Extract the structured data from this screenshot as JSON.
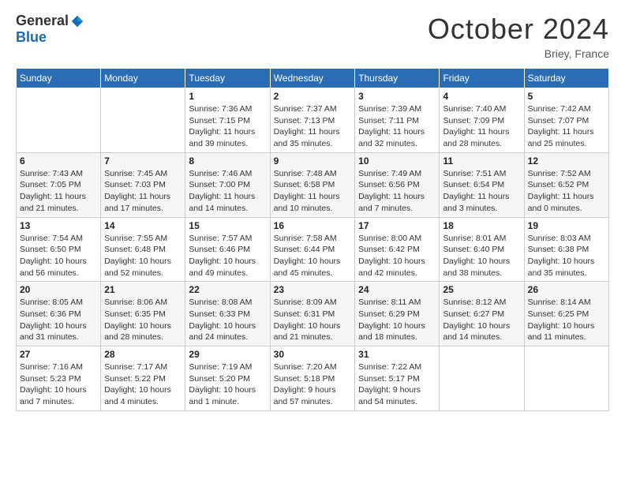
{
  "header": {
    "logo_general": "General",
    "logo_blue": "Blue",
    "month_title": "October 2024",
    "location": "Briey, France"
  },
  "days_of_week": [
    "Sunday",
    "Monday",
    "Tuesday",
    "Wednesday",
    "Thursday",
    "Friday",
    "Saturday"
  ],
  "weeks": [
    [
      {
        "num": "",
        "sunrise": "",
        "sunset": "",
        "daylight": ""
      },
      {
        "num": "",
        "sunrise": "",
        "sunset": "",
        "daylight": ""
      },
      {
        "num": "1",
        "sunrise": "Sunrise: 7:36 AM",
        "sunset": "Sunset: 7:15 PM",
        "daylight": "Daylight: 11 hours and 39 minutes."
      },
      {
        "num": "2",
        "sunrise": "Sunrise: 7:37 AM",
        "sunset": "Sunset: 7:13 PM",
        "daylight": "Daylight: 11 hours and 35 minutes."
      },
      {
        "num": "3",
        "sunrise": "Sunrise: 7:39 AM",
        "sunset": "Sunset: 7:11 PM",
        "daylight": "Daylight: 11 hours and 32 minutes."
      },
      {
        "num": "4",
        "sunrise": "Sunrise: 7:40 AM",
        "sunset": "Sunset: 7:09 PM",
        "daylight": "Daylight: 11 hours and 28 minutes."
      },
      {
        "num": "5",
        "sunrise": "Sunrise: 7:42 AM",
        "sunset": "Sunset: 7:07 PM",
        "daylight": "Daylight: 11 hours and 25 minutes."
      }
    ],
    [
      {
        "num": "6",
        "sunrise": "Sunrise: 7:43 AM",
        "sunset": "Sunset: 7:05 PM",
        "daylight": "Daylight: 11 hours and 21 minutes."
      },
      {
        "num": "7",
        "sunrise": "Sunrise: 7:45 AM",
        "sunset": "Sunset: 7:03 PM",
        "daylight": "Daylight: 11 hours and 17 minutes."
      },
      {
        "num": "8",
        "sunrise": "Sunrise: 7:46 AM",
        "sunset": "Sunset: 7:00 PM",
        "daylight": "Daylight: 11 hours and 14 minutes."
      },
      {
        "num": "9",
        "sunrise": "Sunrise: 7:48 AM",
        "sunset": "Sunset: 6:58 PM",
        "daylight": "Daylight: 11 hours and 10 minutes."
      },
      {
        "num": "10",
        "sunrise": "Sunrise: 7:49 AM",
        "sunset": "Sunset: 6:56 PM",
        "daylight": "Daylight: 11 hours and 7 minutes."
      },
      {
        "num": "11",
        "sunrise": "Sunrise: 7:51 AM",
        "sunset": "Sunset: 6:54 PM",
        "daylight": "Daylight: 11 hours and 3 minutes."
      },
      {
        "num": "12",
        "sunrise": "Sunrise: 7:52 AM",
        "sunset": "Sunset: 6:52 PM",
        "daylight": "Daylight: 11 hours and 0 minutes."
      }
    ],
    [
      {
        "num": "13",
        "sunrise": "Sunrise: 7:54 AM",
        "sunset": "Sunset: 6:50 PM",
        "daylight": "Daylight: 10 hours and 56 minutes."
      },
      {
        "num": "14",
        "sunrise": "Sunrise: 7:55 AM",
        "sunset": "Sunset: 6:48 PM",
        "daylight": "Daylight: 10 hours and 52 minutes."
      },
      {
        "num": "15",
        "sunrise": "Sunrise: 7:57 AM",
        "sunset": "Sunset: 6:46 PM",
        "daylight": "Daylight: 10 hours and 49 minutes."
      },
      {
        "num": "16",
        "sunrise": "Sunrise: 7:58 AM",
        "sunset": "Sunset: 6:44 PM",
        "daylight": "Daylight: 10 hours and 45 minutes."
      },
      {
        "num": "17",
        "sunrise": "Sunrise: 8:00 AM",
        "sunset": "Sunset: 6:42 PM",
        "daylight": "Daylight: 10 hours and 42 minutes."
      },
      {
        "num": "18",
        "sunrise": "Sunrise: 8:01 AM",
        "sunset": "Sunset: 6:40 PM",
        "daylight": "Daylight: 10 hours and 38 minutes."
      },
      {
        "num": "19",
        "sunrise": "Sunrise: 8:03 AM",
        "sunset": "Sunset: 6:38 PM",
        "daylight": "Daylight: 10 hours and 35 minutes."
      }
    ],
    [
      {
        "num": "20",
        "sunrise": "Sunrise: 8:05 AM",
        "sunset": "Sunset: 6:36 PM",
        "daylight": "Daylight: 10 hours and 31 minutes."
      },
      {
        "num": "21",
        "sunrise": "Sunrise: 8:06 AM",
        "sunset": "Sunset: 6:35 PM",
        "daylight": "Daylight: 10 hours and 28 minutes."
      },
      {
        "num": "22",
        "sunrise": "Sunrise: 8:08 AM",
        "sunset": "Sunset: 6:33 PM",
        "daylight": "Daylight: 10 hours and 24 minutes."
      },
      {
        "num": "23",
        "sunrise": "Sunrise: 8:09 AM",
        "sunset": "Sunset: 6:31 PM",
        "daylight": "Daylight: 10 hours and 21 minutes."
      },
      {
        "num": "24",
        "sunrise": "Sunrise: 8:11 AM",
        "sunset": "Sunset: 6:29 PM",
        "daylight": "Daylight: 10 hours and 18 minutes."
      },
      {
        "num": "25",
        "sunrise": "Sunrise: 8:12 AM",
        "sunset": "Sunset: 6:27 PM",
        "daylight": "Daylight: 10 hours and 14 minutes."
      },
      {
        "num": "26",
        "sunrise": "Sunrise: 8:14 AM",
        "sunset": "Sunset: 6:25 PM",
        "daylight": "Daylight: 10 hours and 11 minutes."
      }
    ],
    [
      {
        "num": "27",
        "sunrise": "Sunrise: 7:16 AM",
        "sunset": "Sunset: 5:23 PM",
        "daylight": "Daylight: 10 hours and 7 minutes."
      },
      {
        "num": "28",
        "sunrise": "Sunrise: 7:17 AM",
        "sunset": "Sunset: 5:22 PM",
        "daylight": "Daylight: 10 hours and 4 minutes."
      },
      {
        "num": "29",
        "sunrise": "Sunrise: 7:19 AM",
        "sunset": "Sunset: 5:20 PM",
        "daylight": "Daylight: 10 hours and 1 minute."
      },
      {
        "num": "30",
        "sunrise": "Sunrise: 7:20 AM",
        "sunset": "Sunset: 5:18 PM",
        "daylight": "Daylight: 9 hours and 57 minutes."
      },
      {
        "num": "31",
        "sunrise": "Sunrise: 7:22 AM",
        "sunset": "Sunset: 5:17 PM",
        "daylight": "Daylight: 9 hours and 54 minutes."
      },
      {
        "num": "",
        "sunrise": "",
        "sunset": "",
        "daylight": ""
      },
      {
        "num": "",
        "sunrise": "",
        "sunset": "",
        "daylight": ""
      }
    ]
  ]
}
